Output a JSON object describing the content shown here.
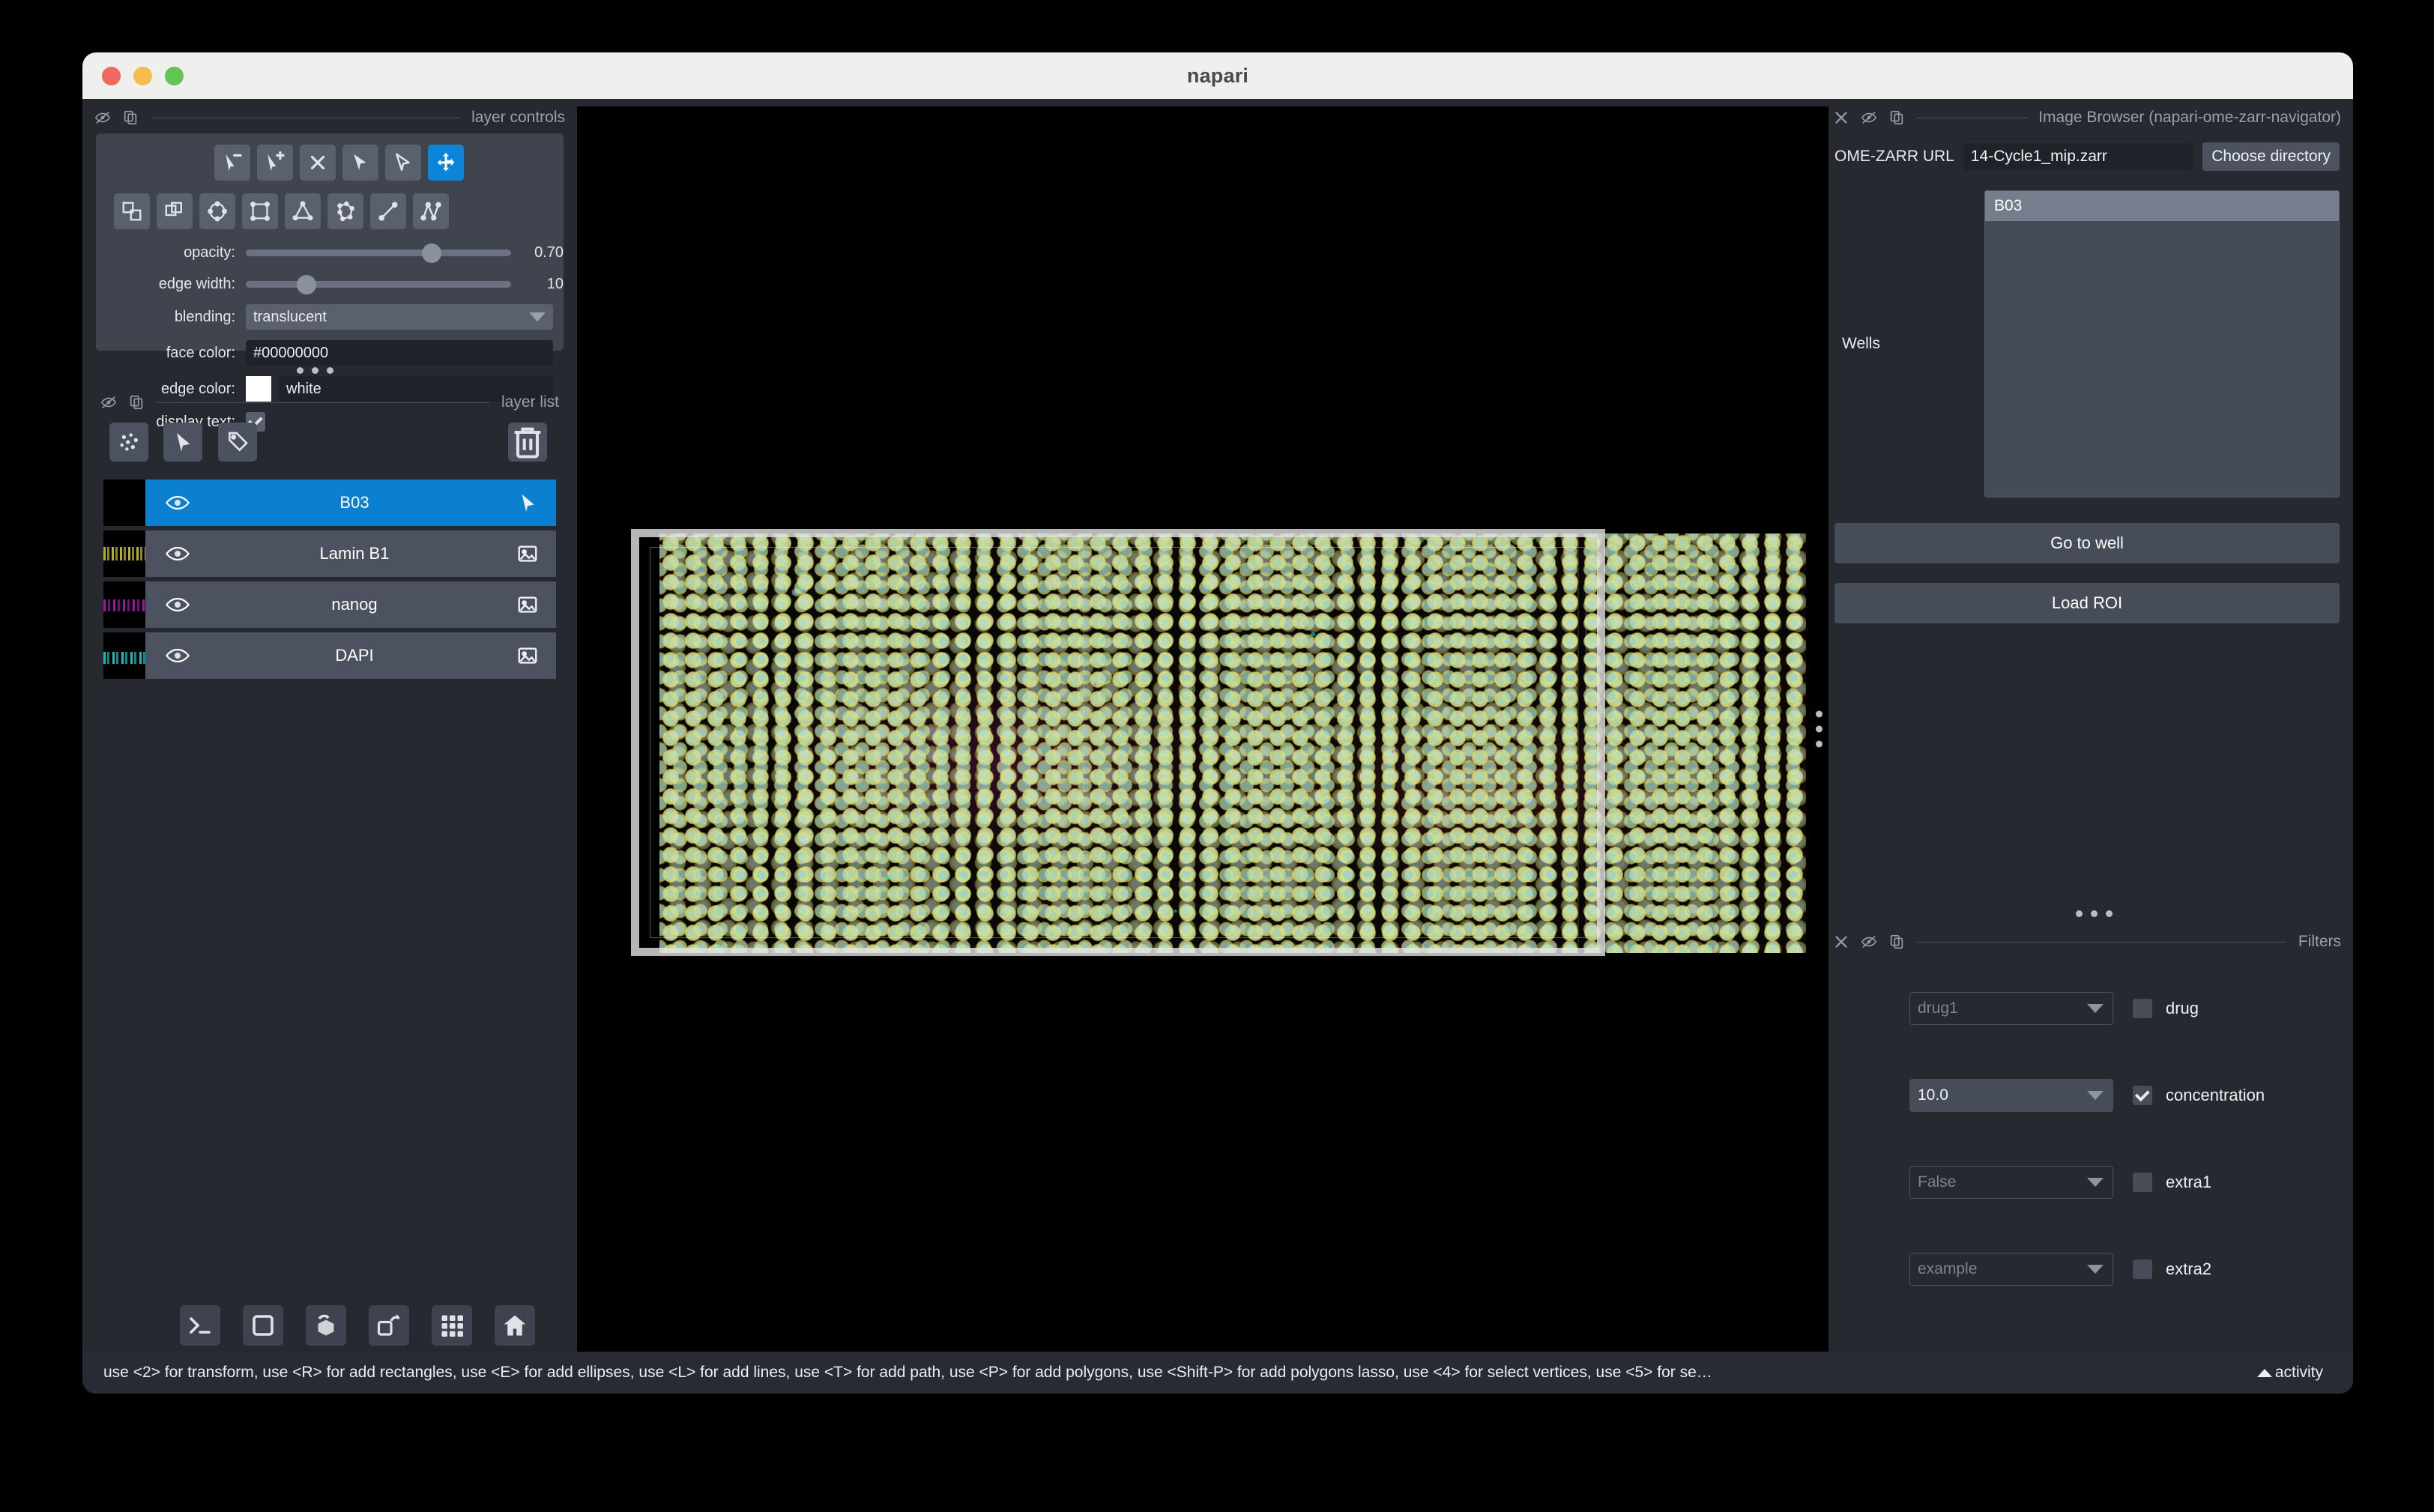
{
  "window": {
    "title": "napari",
    "traffic_lights": [
      "close-red",
      "minimize-yellow",
      "maximize-green"
    ]
  },
  "layer_controls": {
    "panel_title": "layer controls",
    "header_icons": [
      "visibility-off-icon",
      "copy-icon"
    ],
    "tools_row1": [
      {
        "name": "select-remove-vertex-tool",
        "active": false
      },
      {
        "name": "select-add-vertex-tool",
        "active": false
      },
      {
        "name": "delete-shape-tool",
        "active": false
      },
      {
        "name": "select-shapes-tool",
        "active": false
      },
      {
        "name": "direct-select-tool",
        "active": false
      },
      {
        "name": "pan-zoom-tool",
        "active": true
      }
    ],
    "tools_row2": [
      {
        "name": "move-to-front-tool",
        "active": false
      },
      {
        "name": "move-to-back-tool",
        "active": false
      },
      {
        "name": "add-ellipse-tool",
        "active": false
      },
      {
        "name": "add-rectangle-tool",
        "active": false
      },
      {
        "name": "add-polygon-tool",
        "active": false
      },
      {
        "name": "add-polygon-lasso-tool",
        "active": false
      },
      {
        "name": "add-line-tool",
        "active": false
      },
      {
        "name": "add-path-tool",
        "active": false
      }
    ],
    "opacity": {
      "label": "opacity:",
      "value": "0.70",
      "fraction": 0.7
    },
    "edge_width": {
      "label": "edge width:",
      "value": "10",
      "fraction": 0.23
    },
    "blending": {
      "label": "blending:",
      "value": "translucent"
    },
    "face_color": {
      "label": "face color:",
      "value": "#00000000"
    },
    "edge_color": {
      "label": "edge color:",
      "value": "white",
      "swatch": "#ffffff"
    },
    "display_text": {
      "label": "display text:",
      "checked": true
    }
  },
  "layer_list": {
    "panel_title": "layer list",
    "header_icons": [
      "visibility-off-icon",
      "copy-icon"
    ],
    "buttons": [
      {
        "name": "new-points-layer-button"
      },
      {
        "name": "new-shapes-layer-button"
      },
      {
        "name": "new-labels-layer-button"
      }
    ],
    "delete_button": {
      "name": "delete-layer-button"
    },
    "layers": [
      {
        "name": "B03",
        "visible": true,
        "selected": true,
        "type_icon": "shapes-layer-icon"
      },
      {
        "name": "Lamin B1",
        "visible": true,
        "selected": false,
        "type_icon": "image-layer-icon"
      },
      {
        "name": "nanog",
        "visible": true,
        "selected": false,
        "type_icon": "image-layer-icon"
      },
      {
        "name": "DAPI",
        "visible": true,
        "selected": false,
        "type_icon": "image-layer-icon"
      }
    ]
  },
  "bottom_toolbar": [
    {
      "name": "console-button"
    },
    {
      "name": "toggle-2d-3d-button"
    },
    {
      "name": "roll-dimensions-button"
    },
    {
      "name": "transpose-dimensions-button"
    },
    {
      "name": "grid-view-button"
    },
    {
      "name": "reset-view-home-button"
    }
  ],
  "image_browser": {
    "panel_title": "Image Browser (napari-ome-zarr-navigator)",
    "header_icons": [
      "close-icon",
      "visibility-off-icon",
      "copy-icon"
    ],
    "url_label": "OME-ZARR URL",
    "url_value": "14-Cycle1_mip.zarr",
    "choose_directory_label": "Choose directory",
    "wells_label": "Wells",
    "wells": [
      {
        "name": "B03",
        "selected": true
      }
    ],
    "go_to_well_label": "Go to well",
    "load_roi_label": "Load ROI"
  },
  "filters": {
    "panel_title": "Filters",
    "header_icons": [
      "close-icon",
      "visibility-off-icon",
      "copy-icon"
    ],
    "rows": [
      {
        "value": "drug1",
        "label": "drug",
        "checked": false,
        "enabled": false
      },
      {
        "value": "10.0",
        "label": "concentration",
        "checked": true,
        "enabled": true
      },
      {
        "value": "False",
        "label": "extra1",
        "checked": false,
        "enabled": false
      },
      {
        "value": "example",
        "label": "extra2",
        "checked": false,
        "enabled": false
      }
    ]
  },
  "status_bar": {
    "text": "use <2> for transform, use <R> for add rectangles, use <E> for add ellipses, use <L> for add lines, use <T> for add path, use <P> for add polygons, use <Shift-P> for add polygons lasso, use <4> for select vertices, use <5> for se…",
    "activity_label": "activity"
  },
  "colors": {
    "accent": "#0b84d9",
    "panel_bg": "#262930",
    "control_bg": "#40444f",
    "button_bg": "#4d5260",
    "selected_layer": "#0b7fd0",
    "titlebar": "#efefed",
    "roi_border": "#e4e4e4"
  }
}
